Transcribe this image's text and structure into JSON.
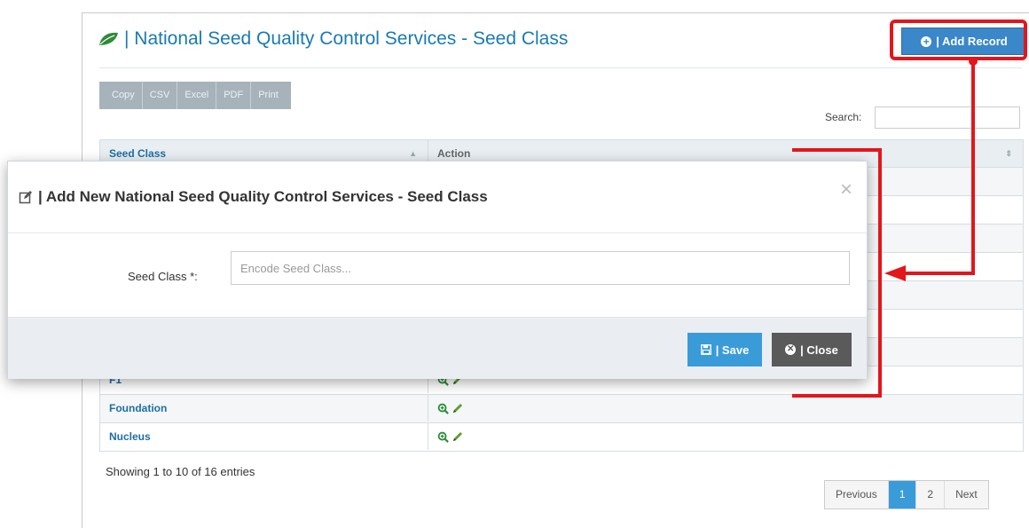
{
  "header": {
    "title": "| National Seed Quality Control Services - Seed Class",
    "add_button": "| Add Record"
  },
  "export_buttons": [
    "Copy",
    "CSV",
    "Excel",
    "PDF",
    "Print"
  ],
  "search": {
    "label": "Search:",
    "value": ""
  },
  "table": {
    "columns": [
      "Seed Class",
      "Action"
    ],
    "rows": [
      {
        "seed_class": "F1"
      },
      {
        "seed_class": "Foundation"
      },
      {
        "seed_class": "Nucleus"
      }
    ]
  },
  "footer": {
    "showing": "Showing 1 to 10 of 16 entries",
    "pagination": [
      "Previous",
      "1",
      "2",
      "Next"
    ]
  },
  "modal": {
    "title": "| Add New National Seed Quality Control Services - Seed Class",
    "close_x": "×",
    "field_label": "Seed Class *:",
    "field_placeholder": "Encode Seed Class...",
    "field_value": "",
    "save_label": "| Save",
    "close_label": "| Close"
  },
  "colors": {
    "accent": "#3a87c9",
    "title_blue": "#1a7bb0",
    "annotation_red": "#e3161b",
    "leaf_green": "#2e8b3a",
    "close_gray": "#5a5a5a"
  },
  "icons": [
    "leaf-icon",
    "plus-circle-icon",
    "edit-icon",
    "zoom-in-icon",
    "pencil-icon",
    "save-icon",
    "x-circle-icon"
  ]
}
